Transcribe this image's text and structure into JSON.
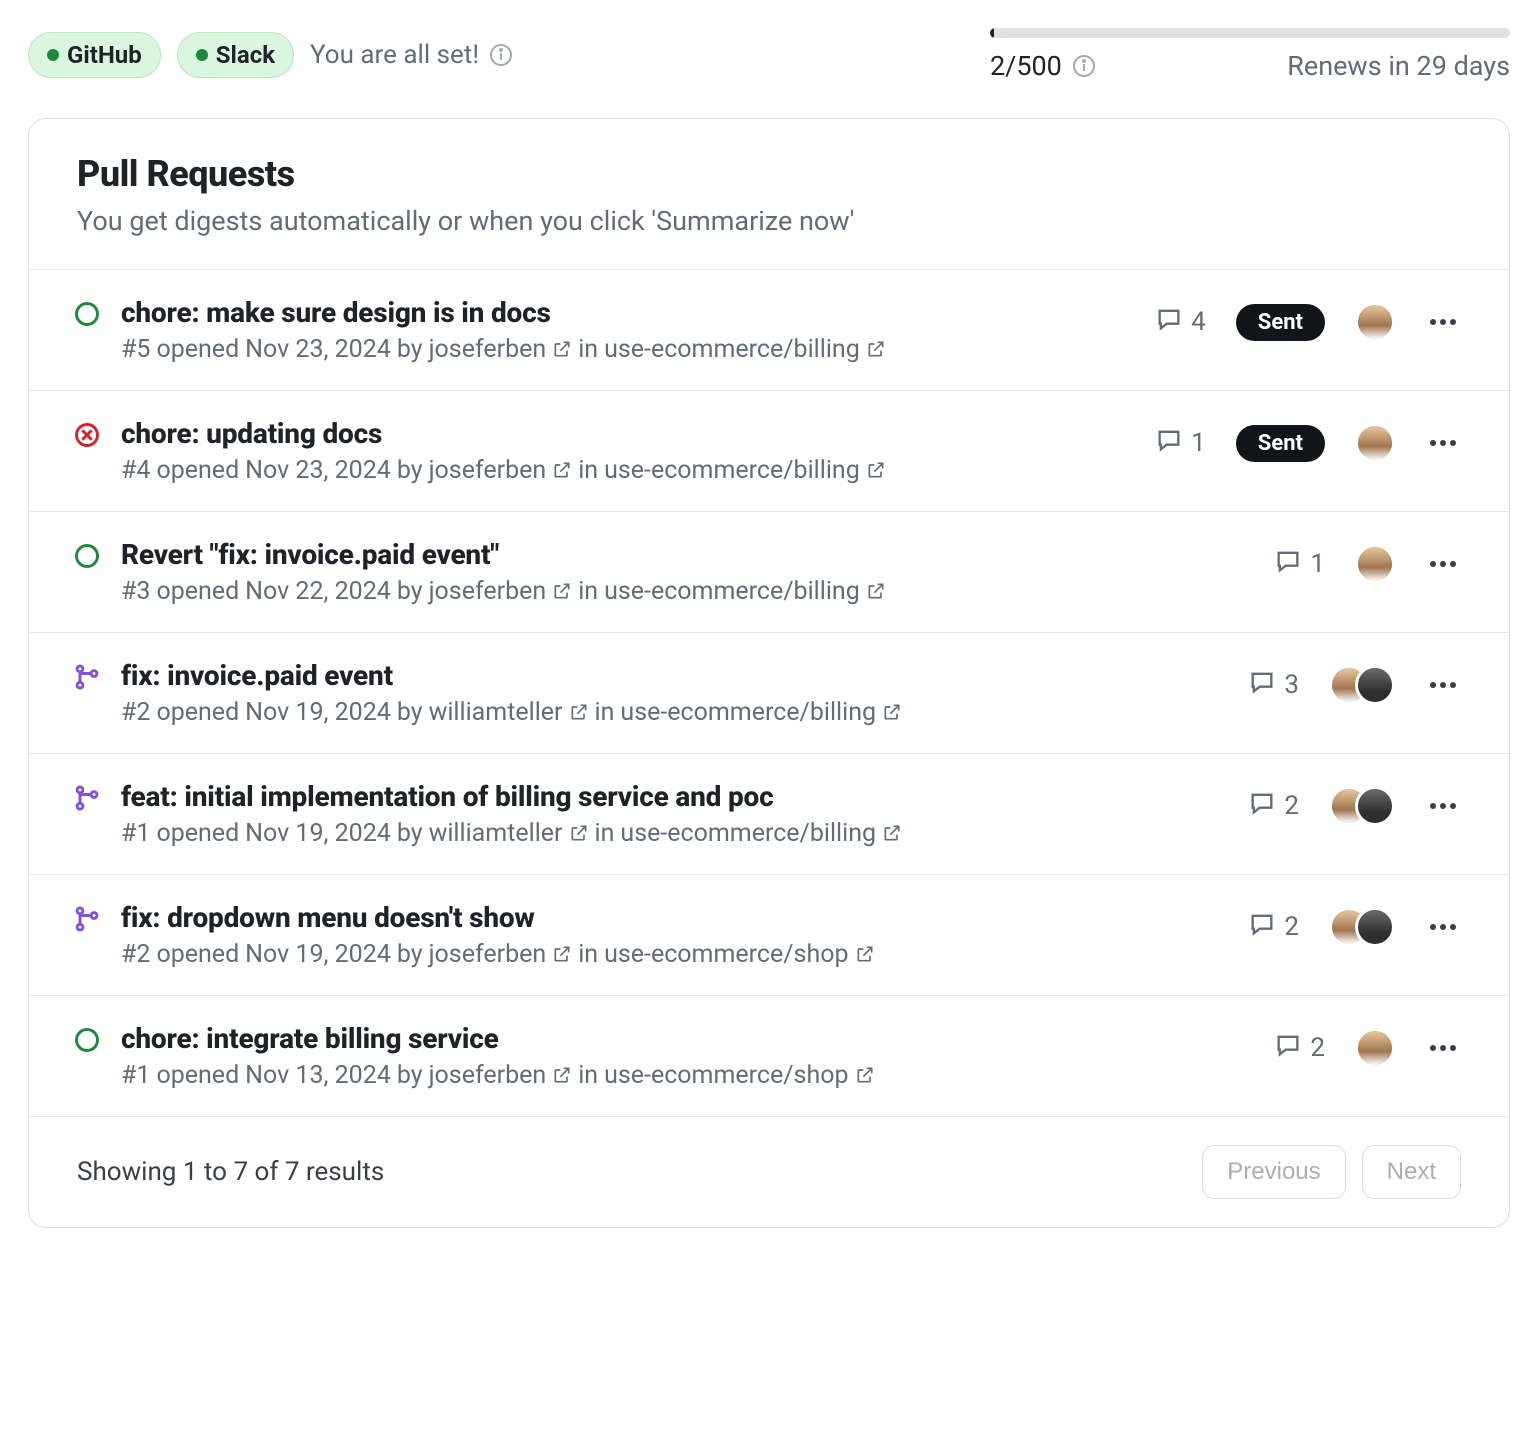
{
  "header": {
    "chips": [
      {
        "label": "GitHub"
      },
      {
        "label": "Slack"
      }
    ],
    "all_set_text": "You are all set!",
    "usage": {
      "count": "2/500",
      "renews": "Renews in 29 days"
    }
  },
  "panel": {
    "title": "Pull Requests",
    "subtitle": "You get digests automatically or when you click 'Summarize now'"
  },
  "prs": [
    {
      "status": "open",
      "title": "chore: make sure design is in docs",
      "num": "#5",
      "date": "Nov 23, 2024",
      "author": "joseferben",
      "repo": "use-ecommerce/billing",
      "comments": "4",
      "sent": true,
      "avatars": 1
    },
    {
      "status": "closed",
      "title": "chore: updating docs",
      "num": "#4",
      "date": "Nov 23, 2024",
      "author": "joseferben",
      "repo": "use-ecommerce/billing",
      "comments": "1",
      "sent": true,
      "avatars": 1
    },
    {
      "status": "open",
      "title": "Revert \"fix: invoice.paid event\"",
      "num": "#3",
      "date": "Nov 22, 2024",
      "author": "joseferben",
      "repo": "use-ecommerce/billing",
      "comments": "1",
      "sent": false,
      "avatars": 1
    },
    {
      "status": "merged",
      "title": "fix: invoice.paid event",
      "num": "#2",
      "date": "Nov 19, 2024",
      "author": "williamteller",
      "repo": "use-ecommerce/billing",
      "comments": "3",
      "sent": false,
      "avatars": 2
    },
    {
      "status": "merged",
      "title": "feat: initial implementation of billing service and poc",
      "num": "#1",
      "date": "Nov 19, 2024",
      "author": "williamteller",
      "repo": "use-ecommerce/billing",
      "comments": "2",
      "sent": false,
      "avatars": 2
    },
    {
      "status": "merged",
      "title": "fix: dropdown menu doesn't show",
      "num": "#2",
      "date": "Nov 19, 2024",
      "author": "joseferben",
      "repo": "use-ecommerce/shop",
      "comments": "2",
      "sent": false,
      "avatars": 2
    },
    {
      "status": "open",
      "title": "chore: integrate billing service",
      "num": "#1",
      "date": "Nov 13, 2024",
      "author": "joseferben",
      "repo": "use-ecommerce/shop",
      "comments": "2",
      "sent": false,
      "avatars": 1
    }
  ],
  "footer": {
    "summary": "Showing 1 to 7 of 7 results",
    "prev": "Previous",
    "next": "Next"
  },
  "labels": {
    "opened": "opened",
    "by": "by",
    "in": "in",
    "sent": "Sent"
  }
}
